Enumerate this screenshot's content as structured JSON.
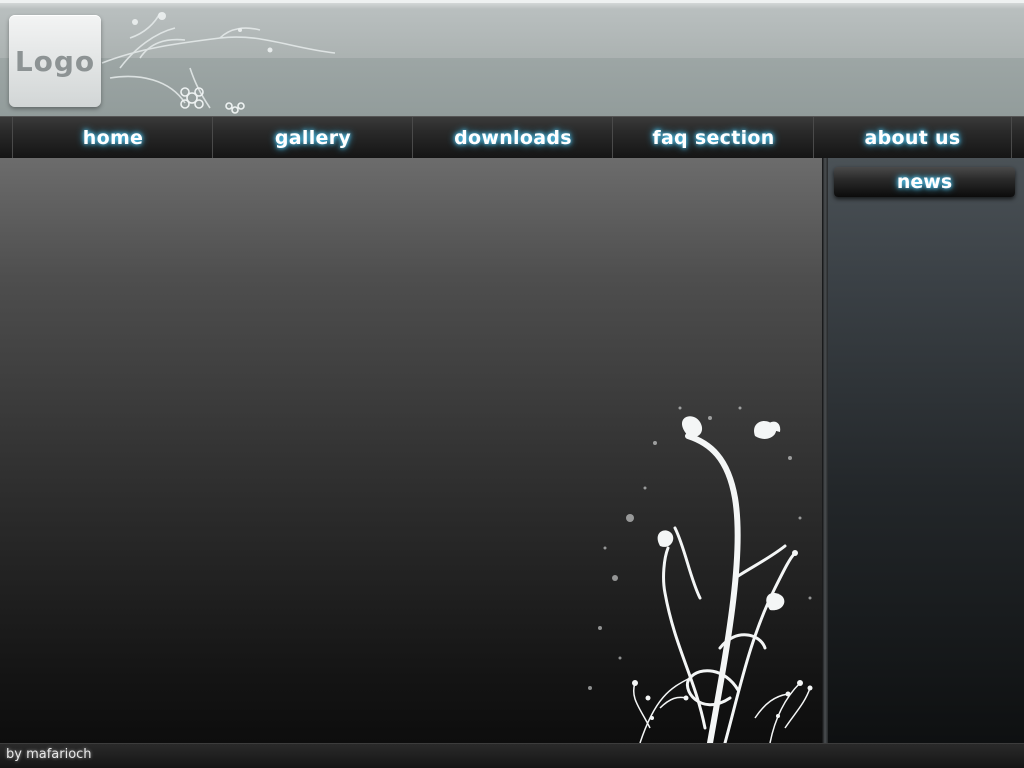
{
  "header": {
    "logo_text": "Logo"
  },
  "nav": {
    "items": [
      {
        "label": "home"
      },
      {
        "label": "gallery"
      },
      {
        "label": "downloads"
      },
      {
        "label": "faq section"
      },
      {
        "label": "about us"
      }
    ]
  },
  "sidebar": {
    "news_label": "news"
  },
  "footer": {
    "credit": "by mafarioch"
  },
  "colors": {
    "glow": "#5fd4ff",
    "header_bg": "#aab1b0",
    "nav_bg": "#1e1e1e"
  },
  "icons": {
    "header_decoration": "floral-swirl",
    "main_decoration": "floral-plant"
  }
}
